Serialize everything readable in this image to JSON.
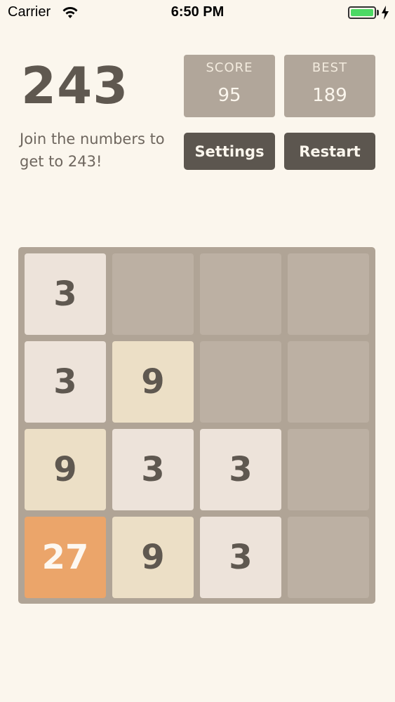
{
  "status_bar": {
    "carrier": "Carrier",
    "time": "6:50 PM",
    "battery_color": "#4cd964"
  },
  "header": {
    "title": "243",
    "subtitle": "Join the numbers to get to 243!"
  },
  "scores": {
    "score_label": "SCORE",
    "score_value": "95",
    "best_label": "BEST",
    "best_value": "189"
  },
  "buttons": {
    "settings_label": "Settings",
    "restart_label": "Restart"
  },
  "board": {
    "rows": 4,
    "cols": 4,
    "cells": [
      [
        "3",
        "",
        "",
        ""
      ],
      [
        "3",
        "9",
        "",
        ""
      ],
      [
        "9",
        "3",
        "3",
        ""
      ],
      [
        "27",
        "9",
        "3",
        ""
      ]
    ]
  },
  "colors": {
    "background": "#fbf6ed",
    "board": "#b0a496",
    "empty_cell": "#bcb0a3",
    "tile_3": "#ede3da",
    "tile_9": "#ecdfc6",
    "tile_27": "#eba56a",
    "button": "#5c564f",
    "score_box": "#b1a69a"
  }
}
